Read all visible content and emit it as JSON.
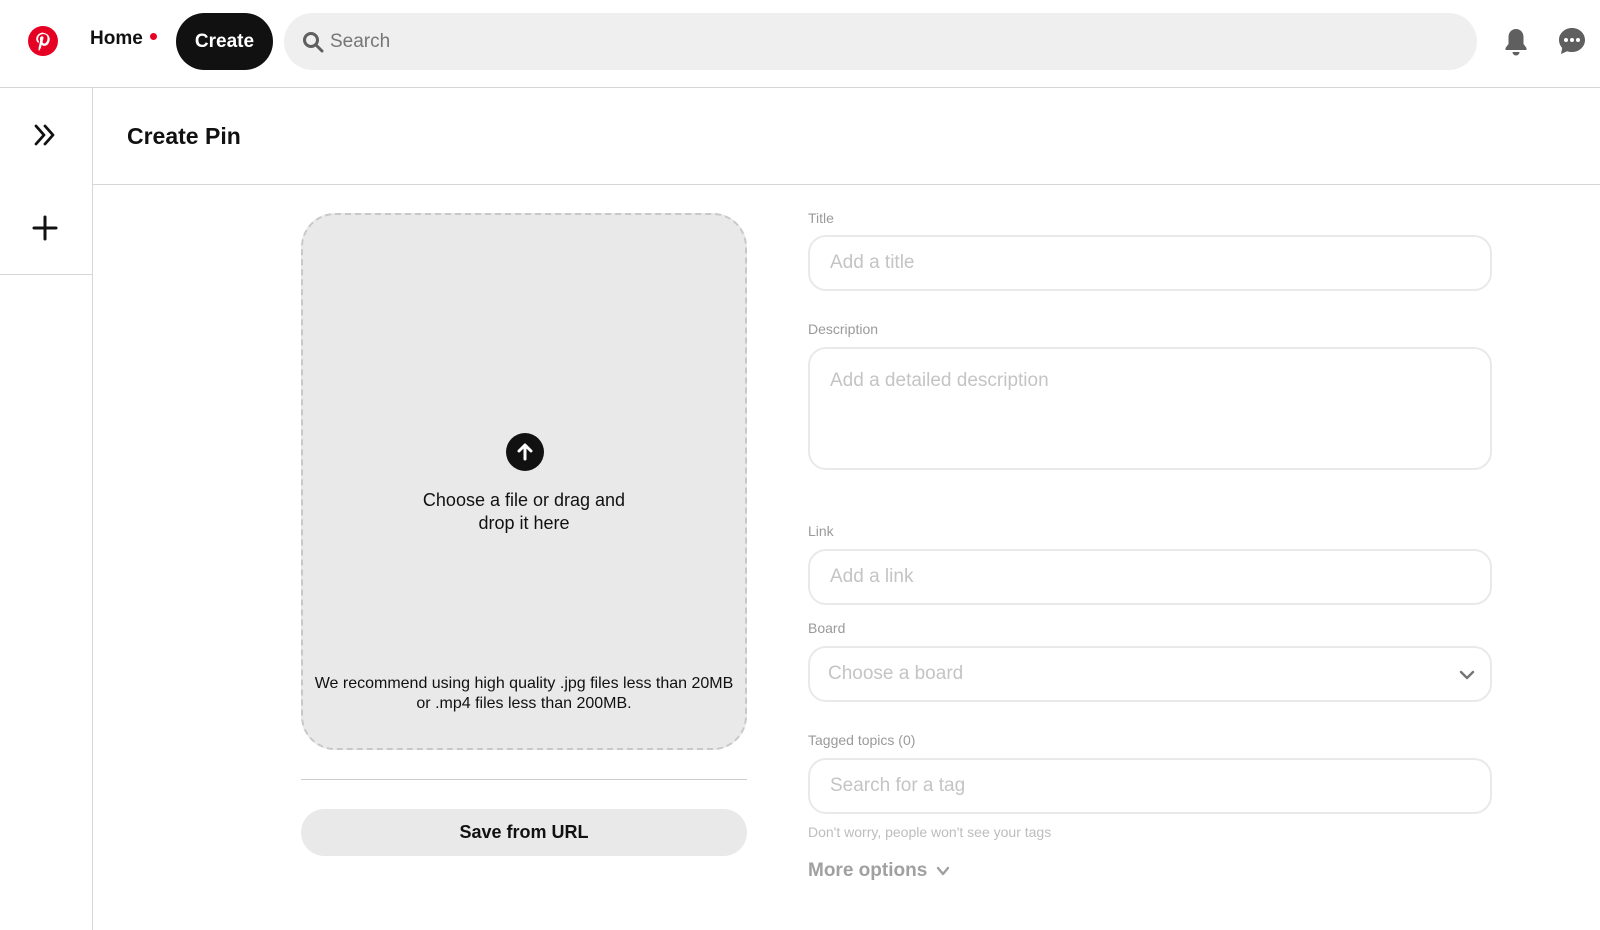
{
  "nav": {
    "home_label": "Home",
    "create_label": "Create",
    "search_placeholder": "Search"
  },
  "page": {
    "title": "Create Pin"
  },
  "upload": {
    "prompt": "Choose a file or drag and drop it here",
    "recommendation": "We recommend using high quality .jpg files less than 20MB or .mp4 files less than 200MB.",
    "save_url_label": "Save from URL"
  },
  "form": {
    "title_label": "Title",
    "title_placeholder": "Add a title",
    "description_label": "Description",
    "description_placeholder": "Add a detailed description",
    "link_label": "Link",
    "link_placeholder": "Add a link",
    "board_label": "Board",
    "board_placeholder": "Choose a board",
    "topics_label": "Tagged topics (0)",
    "topics_placeholder": "Search for a tag",
    "topics_hint": "Don't worry, people won't see your tags",
    "more_options_label": "More options"
  },
  "colors": {
    "brand": "#e60023",
    "primary_button": "#111111",
    "surface": "#e9e9e9"
  }
}
